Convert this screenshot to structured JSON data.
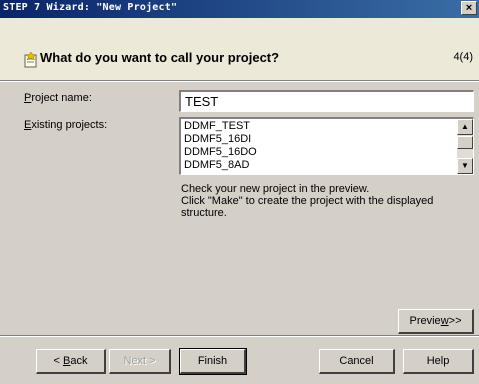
{
  "window": {
    "title": "STEP 7 Wizard: \"New Project\"",
    "close_symbol": "×"
  },
  "header": {
    "icon": "wizard-project-icon",
    "question": "What do you want to call your project?",
    "step": "4(4)"
  },
  "form": {
    "project_name_label_mnemonic": "P",
    "project_name_label_rest": "roject name:",
    "project_name_value": "TEST",
    "existing_label_mnemonic": "E",
    "existing_label_rest": "xisting projects:",
    "existing_projects": [
      "DDMF_TEST",
      "DDMF5_16DI",
      "DDMF5_16DO",
      "DDMF5_8AD"
    ]
  },
  "info": {
    "line1": "Check your new project in the preview.",
    "line2": "Click \"Make\" to create the project with the displayed",
    "line3": "structure."
  },
  "buttons": {
    "preview_prefix": "Previe",
    "preview_mnemonic": "w",
    "preview_suffix": ">>",
    "back_prefix": "< ",
    "back_mnemonic": "B",
    "back_suffix": "ack",
    "next_label": "Next >",
    "finish_label": "Finish",
    "cancel_label": "Cancel",
    "help_label": "Help"
  }
}
